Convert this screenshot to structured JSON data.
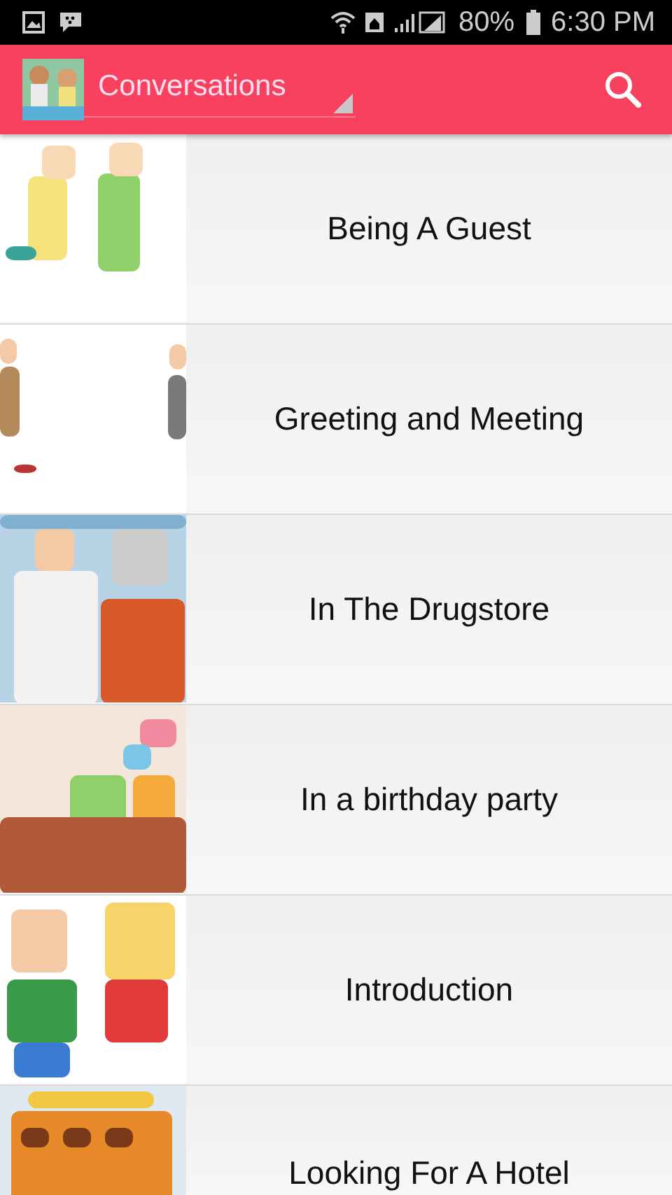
{
  "status_bar": {
    "battery": "80%",
    "time": "6:30 PM"
  },
  "app_bar": {
    "title": "Conversations"
  },
  "items": [
    {
      "title": "Being A Guest"
    },
    {
      "title": "Greeting and Meeting"
    },
    {
      "title": "In The Drugstore"
    },
    {
      "title": "In a birthday party"
    },
    {
      "title": "Introduction"
    },
    {
      "title": "Looking For A Hotel"
    }
  ]
}
